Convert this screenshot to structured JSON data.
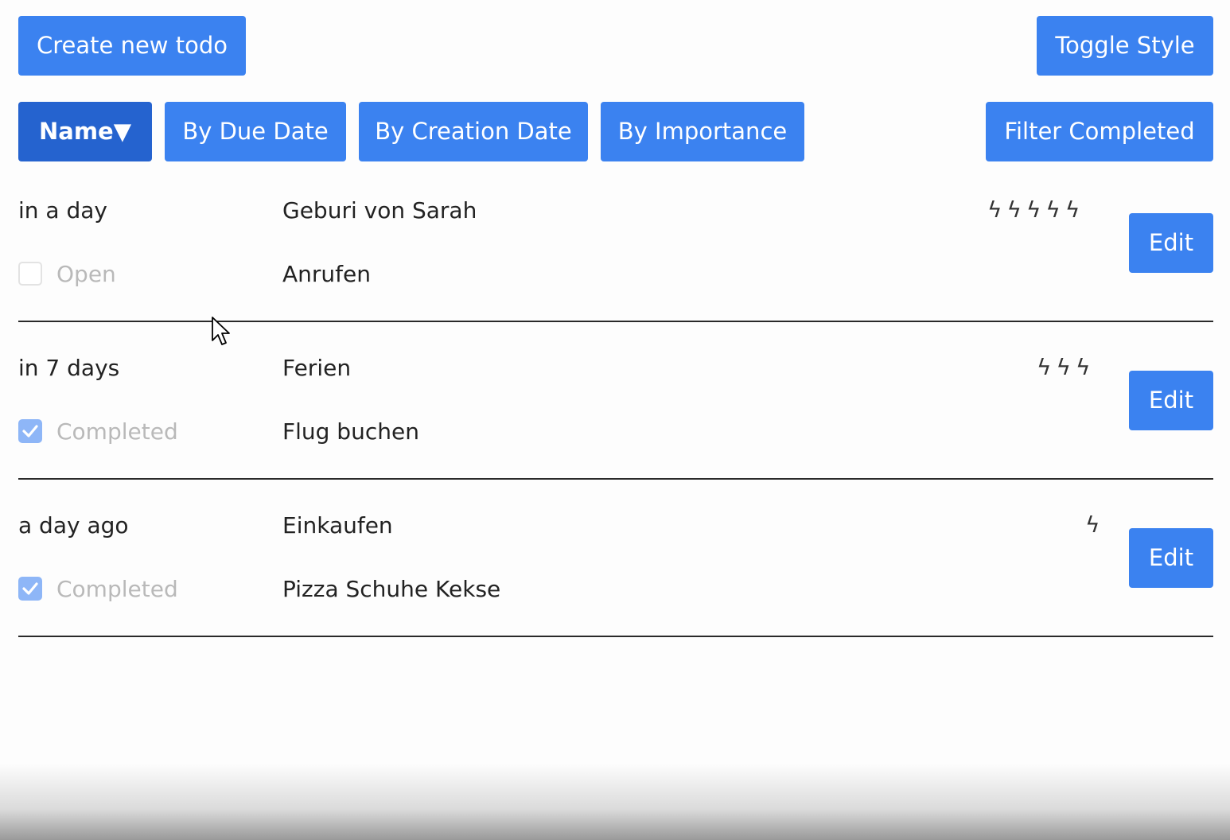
{
  "toolbar": {
    "create_label": "Create new todo",
    "toggle_style_label": "Toggle Style"
  },
  "sort_bar": {
    "name_label": "Name▼",
    "due_date_label": "By Due Date",
    "creation_date_label": "By Creation Date",
    "importance_label": "By Importance",
    "filter_completed_label": "Filter Completed",
    "active_sort": "Name"
  },
  "todos": [
    {
      "due": "in a day",
      "title": "Geburi von Sarah",
      "description": "Anrufen",
      "status_label": "Open",
      "completed": false,
      "importance": 5,
      "importance_glyph": "ϟ",
      "importance_display": "ϟϟϟϟϟ",
      "edit_label": "Edit"
    },
    {
      "due": "in 7 days",
      "title": "Ferien",
      "description": "Flug buchen",
      "status_label": "Completed",
      "completed": true,
      "importance": 3,
      "importance_glyph": "ϟ",
      "importance_display": "ϟϟϟ",
      "edit_label": "Edit"
    },
    {
      "due": "a day ago",
      "title": "Einkaufen",
      "description": "Pizza Schuhe Kekse",
      "status_label": "Completed",
      "completed": true,
      "importance": 1,
      "importance_glyph": "ϟ",
      "importance_display": "ϟ",
      "edit_label": "Edit"
    }
  ],
  "colors": {
    "primary": "#3b82f0",
    "primary_active": "#2563cf",
    "checkbox_checked": "#8eb6f7",
    "muted_text": "#b9b9b9"
  }
}
